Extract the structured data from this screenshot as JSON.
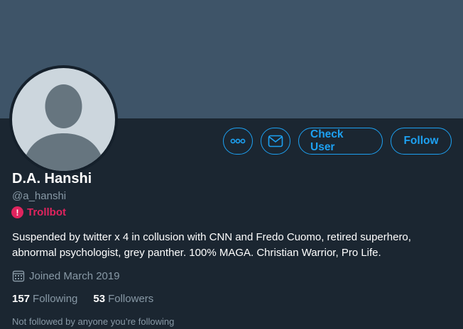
{
  "profile": {
    "display_name": "D.A. Hanshi",
    "handle": "@a_hanshi",
    "badge_label": "Trollbot",
    "badge_symbol": "!",
    "bio": "Suspended by twitter x 4 in collusion with CNN and Fredo Cuomo, retired superhero, abnormal psychologist, grey panther. 100% MAGA. Christian Warrior, Pro Life.",
    "joined": "Joined March 2019",
    "following_count": "157",
    "following_label": "Following",
    "followers_count": "53",
    "followers_label": "Followers",
    "followed_by": "Not followed by anyone you’re following"
  },
  "actions": {
    "more_icon": "more-icon",
    "message_icon": "mail-icon",
    "check_user_label": "Check User",
    "follow_label": "Follow"
  },
  "colors": {
    "accent": "#1da1f2",
    "badge": "#e0245e",
    "background": "#1b2631",
    "banner": "#3e5468"
  }
}
